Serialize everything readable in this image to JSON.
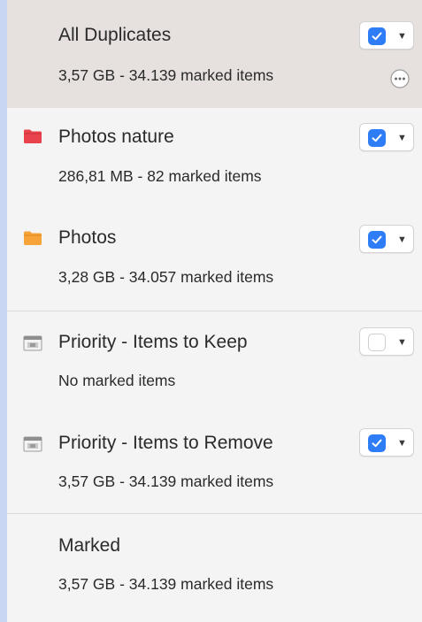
{
  "duplicate_groups": [
    {
      "title": "All Duplicates",
      "subtitle": "3,57 GB - 34.139 marked items",
      "checked": true,
      "selected": true,
      "icon": "none",
      "has_more_button": true
    },
    {
      "title": "Photos nature",
      "subtitle": "286,81 MB - 82 marked items",
      "checked": true,
      "selected": false,
      "icon": "red-folder-icon",
      "icon_color": "#e8434c"
    },
    {
      "title": "Photos",
      "subtitle": "3,28 GB - 34.057 marked items",
      "checked": true,
      "selected": false,
      "icon": "orange-folder-icon",
      "icon_color": "#f6a33a"
    }
  ],
  "priority_groups": [
    {
      "title": "Priority - Items to Keep",
      "subtitle": "No marked items",
      "checked": false,
      "icon": "priority-list-icon"
    },
    {
      "title": "Priority - Items to Remove",
      "subtitle": "3,57 GB - 34.139 marked items",
      "checked": true,
      "icon": "priority-list-icon"
    }
  ],
  "marked": {
    "title": "Marked",
    "subtitle": "3,57 GB - 34.139 marked items"
  },
  "colors": {
    "checkbox_blue": "#2e7cf6",
    "selected_row": "#e6e1df",
    "accent_strip": "#c9d6f3"
  }
}
